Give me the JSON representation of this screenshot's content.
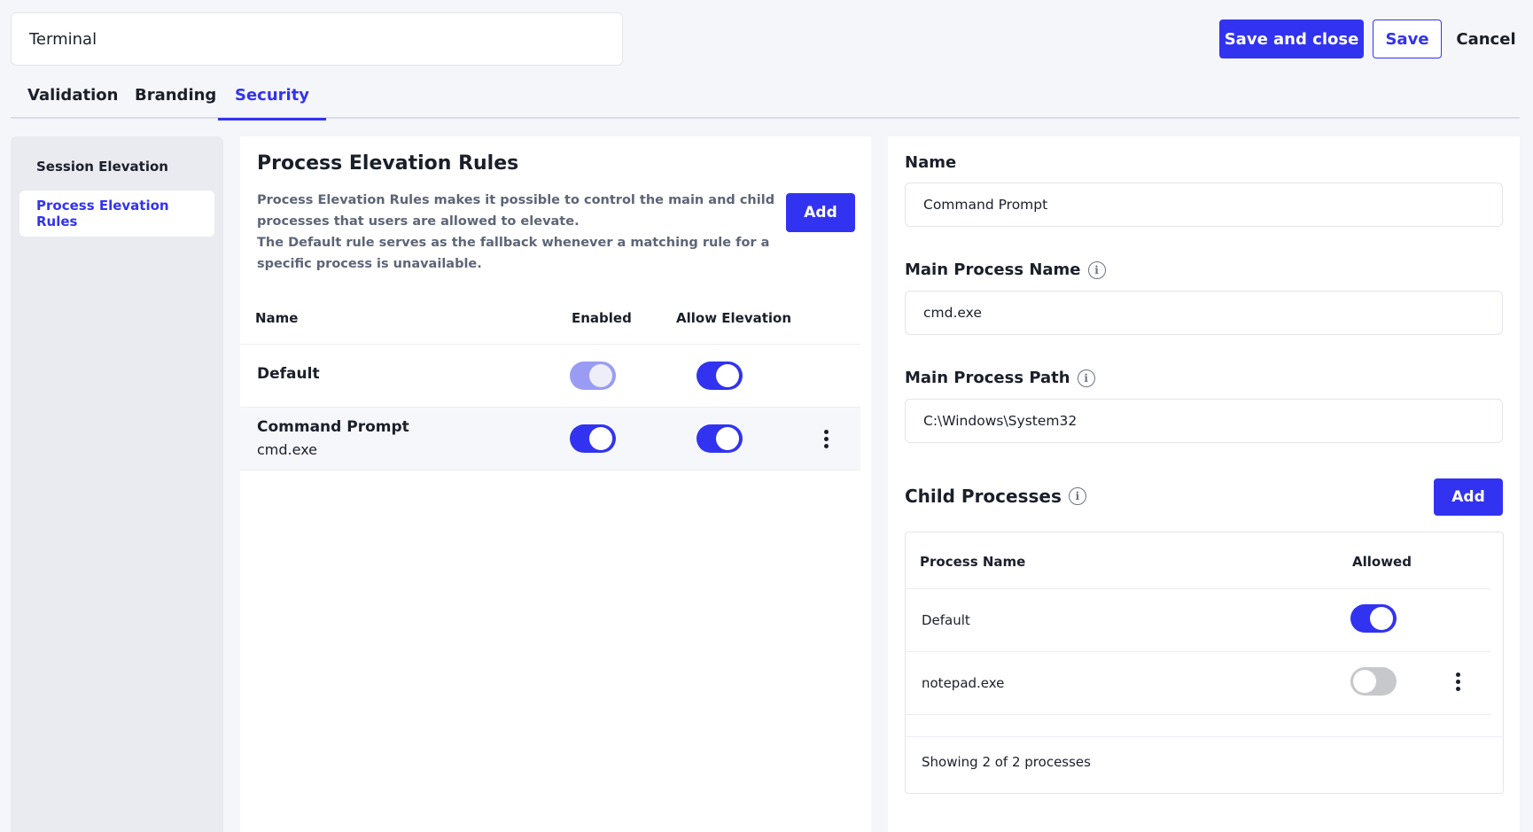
{
  "header": {
    "title_value": "Terminal",
    "save_and_close_label": "Save and close",
    "save_label": "Save",
    "cancel_label": "Cancel"
  },
  "tabs": [
    {
      "label": "Validation",
      "active": false
    },
    {
      "label": "Branding",
      "active": false
    },
    {
      "label": "Security",
      "active": true
    }
  ],
  "sidebar": {
    "items": [
      {
        "label": "Session Elevation",
        "active": false
      },
      {
        "label": "Process Elevation Rules",
        "active": true
      }
    ]
  },
  "rules_panel": {
    "title": "Process Elevation Rules",
    "description_1": "Process Elevation Rules makes it possible to control the main and child processes that users are allowed to elevate.",
    "description_2": "The Default rule serves as the fallback whenever a matching rule for a specific process is unavailable.",
    "add_label": "Add",
    "columns": {
      "name": "Name",
      "enabled": "Enabled",
      "allow_elevation": "Allow Elevation"
    },
    "rows": [
      {
        "name": "Default",
        "subtitle": "",
        "enabled": true,
        "enabled_disabled": true,
        "allow_elevation": true
      },
      {
        "name": "Command Prompt",
        "subtitle": "cmd.exe",
        "enabled": true,
        "enabled_disabled": false,
        "allow_elevation": true
      }
    ]
  },
  "detail_panel": {
    "name_label": "Name",
    "name_value": "Command Prompt",
    "main_process_name_label": "Main Process Name",
    "main_process_name_value": "cmd.exe",
    "main_process_path_label": "Main Process Path",
    "main_process_path_value": "C:\\Windows\\System32",
    "child_processes_label": "Child Processes",
    "add_label": "Add",
    "info_glyph": "i",
    "child_table": {
      "columns": {
        "process_name": "Process Name",
        "allowed": "Allowed"
      },
      "rows": [
        {
          "name": "Default",
          "allowed": true
        },
        {
          "name": "notepad.exe",
          "allowed": false
        }
      ],
      "footer": "Showing 2 of 2 processes"
    }
  },
  "colors": {
    "accent": "#3233f0",
    "background": "#f5f6fa",
    "toggle_off": "#c7c8cc",
    "toggle_disabled_on": "#9a9cf4"
  },
  "icons": [
    "info-icon",
    "kebab-menu-icon"
  ]
}
